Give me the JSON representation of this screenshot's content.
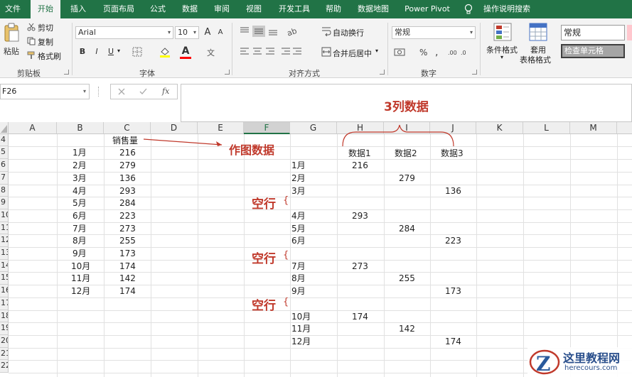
{
  "tabs": [
    "文件",
    "开始",
    "插入",
    "页面布局",
    "公式",
    "数据",
    "审阅",
    "视图",
    "开发工具",
    "帮助",
    "数据地图",
    "Power Pivot",
    "操作说明搜索"
  ],
  "active_tab": "开始",
  "clipboard": {
    "paste": "粘贴",
    "cut": "剪切",
    "copy": "复制",
    "format_painter": "格式刷",
    "label": "剪贴板"
  },
  "font": {
    "name": "Arial",
    "size": "10",
    "bold": "B",
    "italic": "I",
    "underline": "U",
    "grow": "A",
    "shrink": "A",
    "label": "字体",
    "color_accent": "#ff0000"
  },
  "alignment": {
    "wrap": "自动换行",
    "merge": "合并后居中",
    "label": "对齐方式"
  },
  "number": {
    "format": "常规",
    "label": "数字"
  },
  "styles": {
    "conditional": "条件格式",
    "table_format_1": "套用",
    "table_format_2": "表格格式",
    "style_normal": "常规",
    "style_check": "检查单元格"
  },
  "formula_bar": {
    "name_box": "F26",
    "fx": "fx"
  },
  "columns": [
    "A",
    "B",
    "C",
    "D",
    "E",
    "F",
    "G",
    "H",
    "I",
    "J",
    "K",
    "L",
    "M"
  ],
  "rows": [
    "4",
    "5",
    "6",
    "7",
    "8",
    "9",
    "10",
    "11",
    "12",
    "13",
    "14",
    "15",
    "16",
    "17",
    "18",
    "19",
    "20",
    "21",
    "22"
  ],
  "sheet": {
    "sales_header": "销售量",
    "months": [
      "1月",
      "2月",
      "3月",
      "4月",
      "5月",
      "6月",
      "7月",
      "8月",
      "9月",
      "10月",
      "11月",
      "12月"
    ],
    "sales": [
      "216",
      "279",
      "136",
      "293",
      "284",
      "223",
      "273",
      "255",
      "173",
      "174",
      "142",
      "174"
    ],
    "data_headers": [
      "数据1",
      "数据2",
      "数据3"
    ]
  },
  "annotations": {
    "chart_data": "作图数据",
    "three_cols": "3列数据",
    "blank_row": "空行",
    "color": "#c0392b"
  },
  "watermark": {
    "brand": "这里教程网",
    "domain": "herecours.com"
  }
}
